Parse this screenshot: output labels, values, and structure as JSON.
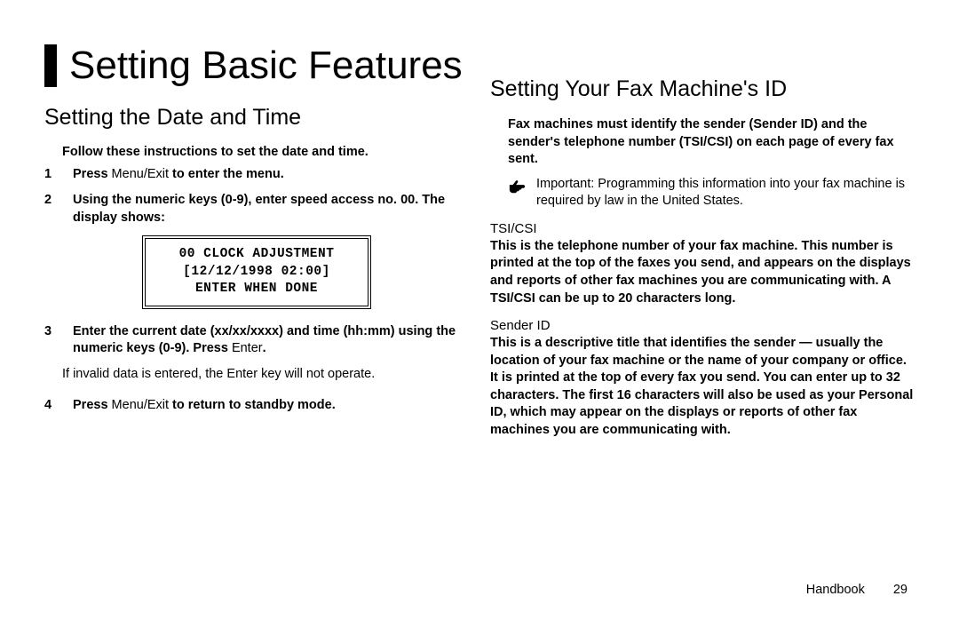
{
  "left": {
    "heading": "Setting Basic Features",
    "section": "Setting the Date and Time",
    "intro": "Follow these instructions to set the date and time.",
    "step1_pre": "Press ",
    "step1_key": "Menu/Exit",
    "step1_post": " to enter the menu.",
    "step2": "Using the numeric keys (0-9), enter speed access no. 00. The display shows:",
    "lcd_line1": "00 CLOCK ADJUSTMENT",
    "lcd_line2": "[12/12/1998 02:00]",
    "lcd_line3": "ENTER WHEN DONE",
    "step3_a": "Enter the current date (xx/xx/xxxx) and time (hh:mm) using the numeric keys (0-9). Press ",
    "step3_key": "Enter",
    "step3_b": ".",
    "note": "If invalid data is entered, the Enter key will not operate.",
    "step4_pre": "Press ",
    "step4_key": "Menu/Exit",
    "step4_post": " to return to standby mode."
  },
  "right": {
    "section": "Setting Your Fax Machine's ID",
    "rule": "Fax machines must identify the sender (Sender ID) and the sender's telephone number (TSI/CSI) on each page of every fax sent.",
    "important": "Important: Programming this information into your fax machine is required by law in the United States.",
    "tsi_label": "TSI/CSI",
    "tsi_body": "This is the telephone number of your fax machine. This number is printed at the top of the faxes you send, and appears on the displays and reports of other fax machines you are communicating with. A TSI/CSI can be up to 20 characters long.",
    "sender_label": "Sender ID",
    "sender_body": "This is a descriptive title that identifies the sender — usually the location of your fax machine or the name of your company or office. It is printed at the top of every fax you send. You can enter up to 32 characters. The first 16 characters will also be used as your Personal ID, which may appear on the displays or reports of other fax machines you are communicating with."
  },
  "footer": {
    "book": "Handbook",
    "page": "29"
  }
}
